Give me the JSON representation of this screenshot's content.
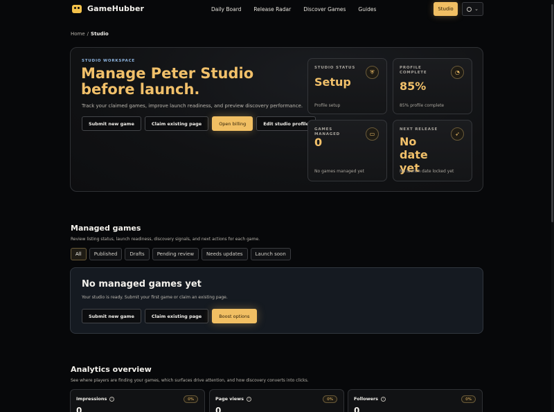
{
  "header": {
    "brand": "GameHubber",
    "nav": [
      "Daily Board",
      "Release Radar",
      "Discover Games",
      "Guides"
    ],
    "studio_button": "Studio",
    "language_icon": "globe-icon",
    "chevron": "⌄"
  },
  "breadcrumb": {
    "home": "Home",
    "separator": "/",
    "current": "Studio"
  },
  "hero": {
    "eyebrow": "STUDIO WORKSPACE",
    "title": "Manage Peter Studio before launch.",
    "subtitle": "Track your claimed games, improve launch readiness, and preview discovery performance.",
    "buttons": {
      "submit": "Submit new game",
      "claim": "Claim existing page",
      "billing": "Open billing",
      "edit": "Edit studio profile"
    },
    "stats": [
      {
        "label": "STUDIO STATUS",
        "value": "Setup",
        "foot": "Profile setup",
        "icon": "shield-icon"
      },
      {
        "label": "PROFILE COMPLETE",
        "value": "85%",
        "foot": "85% profile complete",
        "icon": "gauge-icon"
      },
      {
        "label": "GAMES MANAGED",
        "value": "0",
        "foot": "No games managed yet",
        "icon": "folder-icon"
      },
      {
        "label": "NEXT RELEASE",
        "value": "No date yet",
        "foot": "No launch date locked yet",
        "icon": "rocket-icon"
      }
    ]
  },
  "managed": {
    "title": "Managed games",
    "subtitle": "Review listing status, launch readiness, discovery signals, and next actions for each game.",
    "tabs": [
      "All",
      "Published",
      "Drafts",
      "Pending review",
      "Needs updates",
      "Launch soon"
    ],
    "active_tab": "All",
    "empty": {
      "title": "No managed games yet",
      "subtitle": "Your studio is ready. Submit your first game or claim an existing page.",
      "buttons": {
        "submit": "Submit new game",
        "claim": "Claim existing page",
        "boost": "Boost options"
      }
    }
  },
  "analytics": {
    "title": "Analytics overview",
    "subtitle": "See where players are finding your games, which surfaces drive attention, and how discovery converts into clicks.",
    "metrics": [
      {
        "label": "Impressions",
        "badge": "0%",
        "value": "0"
      },
      {
        "label": "Page views",
        "badge": "0%",
        "value": "0"
      },
      {
        "label": "Followers",
        "badge": "0%",
        "value": "0"
      }
    ]
  },
  "colors": {
    "accent": "#f1bf63",
    "background": "#07080a",
    "eyebrow": "#8fb6e3"
  }
}
